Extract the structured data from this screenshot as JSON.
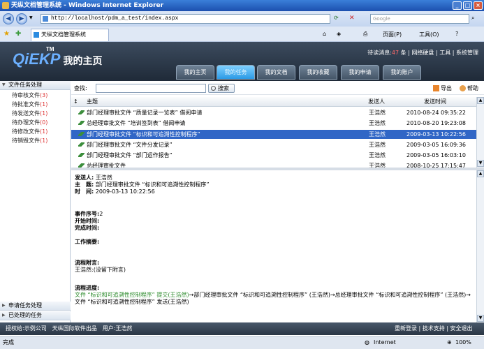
{
  "browser": {
    "window_title": "天纵文档管理系统 - Windows Internet Explorer",
    "url": "http://localhost/pdm_a_test/index.aspx",
    "search_placeholder": "Google",
    "tab_title": "天纵文档管理系统",
    "toolbar": {
      "page": "页面(P)",
      "tools": "工具(O)"
    },
    "status_left": "完成",
    "status_zone": "Internet",
    "zoom": "100%"
  },
  "header": {
    "logo_tm": "TM",
    "logo_main": "QiEKP",
    "logo_cn": "我的主页",
    "msg_prefix": "待读消息:",
    "msg_count": "47",
    "msg_suffix": "条",
    "links": [
      "网络硬盘",
      "工具",
      "系统管理"
    ],
    "tabs": [
      "我的主页",
      "我的任务",
      "我的文档",
      "我的收藏",
      "我的申请",
      "我的账户"
    ],
    "active_tab": 1
  },
  "sidebar": {
    "section1": "文件任务处理",
    "items": [
      {
        "label": "待审核文件",
        "count": "(3)"
      },
      {
        "label": "待批准文件",
        "count": "(1)"
      },
      {
        "label": "待发送文件",
        "count": "(1)"
      },
      {
        "label": "待办理文件",
        "count": "(0)"
      },
      {
        "label": "待修改文件",
        "count": "(1)"
      },
      {
        "label": "待销毁文件",
        "count": "(1)"
      }
    ],
    "section2": "申请任务处理",
    "section3": "已处理的任务"
  },
  "search": {
    "label": "查找:",
    "button": "搜索",
    "export": "导出",
    "help": "帮助"
  },
  "list": {
    "columns": {
      "subject": "主题",
      "sender": "发送人",
      "time": "发送时间"
    },
    "rows": [
      {
        "subject": "部门经理审批文件 “质量记录一览表” 借阅申请",
        "sender": "王浩然",
        "time": "2010-08-24 09:35:22"
      },
      {
        "subject": "总经理审批文件 “培训签到表” 借阅申请",
        "sender": "王浩然",
        "time": "2010-08-20 19:23:08"
      },
      {
        "subject": "部门经理审批文件 “标识和可追溯性控制程序”",
        "sender": "王浩然",
        "time": "2009-03-13 10:22:56"
      },
      {
        "subject": "部门经理审批文件 “文件分发记录”",
        "sender": "王浩然",
        "time": "2009-03-05 16:09:36"
      },
      {
        "subject": "部门经理审批文件 “部门运作报告”",
        "sender": "王浩然",
        "time": "2009-03-05 16:03:10"
      },
      {
        "subject": "总经理审批文件",
        "sender": "王浩然",
        "time": "2008-10-25 17:15:47"
      }
    ],
    "selected_row": 2
  },
  "detail": {
    "sender_label": "发送人:",
    "sender": "王浩然",
    "subject_label": "主　题:",
    "subject": "部门经理审批文件 “标识和可追溯性控制程序”",
    "time_label": "时　间:",
    "time": "2009-03-13 10:22:56",
    "seq_label": "事件序号:",
    "seq": "2",
    "start_label": "开始时间:",
    "end_label": "完成时间:",
    "summary_label": "工作摘要:",
    "notes_label": "流程附言:",
    "notes": "王浩然:(没留下附言)",
    "progress_label": "流程进度:",
    "progress_green": "文件 “标识和可追溯性控制程序” 提交(王浩然)",
    "progress_rest": "→部门经理审批文件 “标识和可追溯性控制程序” (王浩然)→总经理审批文件 “标识和可追溯性控制程序” (王浩然)→文件 “标识和可追溯性控制程序” 发送(王浩然)"
  },
  "footer": {
    "left": "授权给:示例公司　天纵国际软件出品　用户:王浩然",
    "right": "重新登录 | 技术支持 | 安全退出"
  }
}
